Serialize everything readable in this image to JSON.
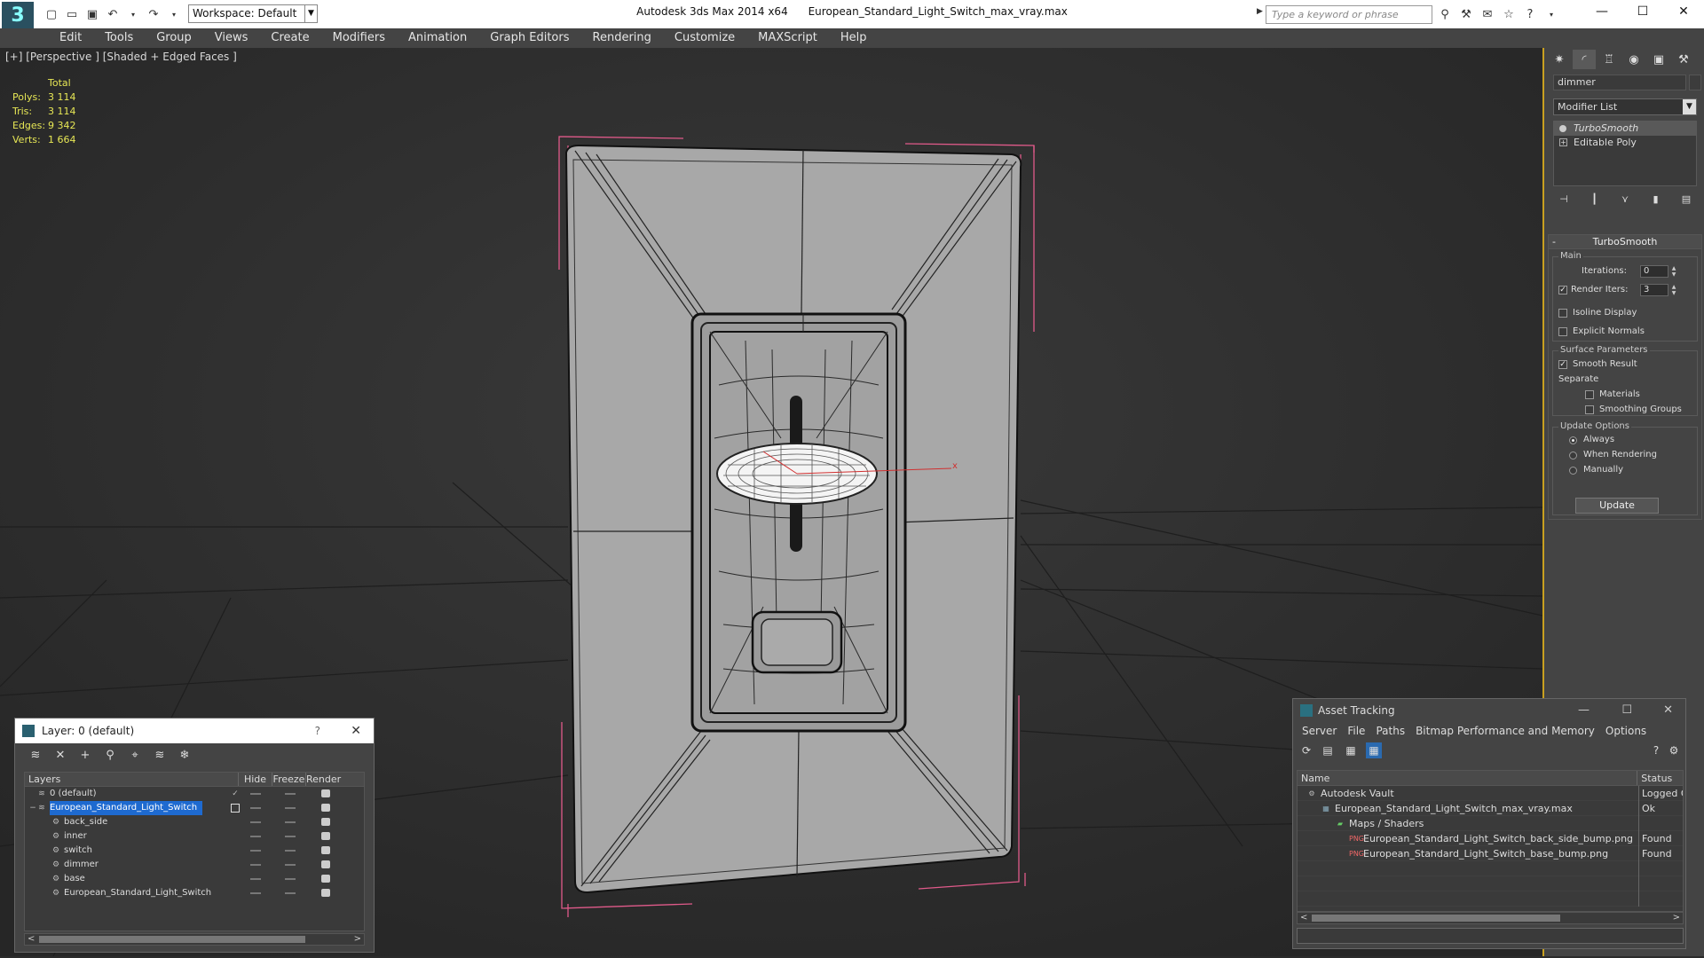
{
  "window": {
    "title": "Autodesk 3ds Max 2014 x64      European_Standard_Light_Switch_max_vray.max",
    "workspace": "Workspace: Default",
    "search_placeholder": "Type a keyword or phrase"
  },
  "menu": [
    "Edit",
    "Tools",
    "Group",
    "Views",
    "Create",
    "Modifiers",
    "Animation",
    "Graph Editors",
    "Rendering",
    "Customize",
    "MAXScript",
    "Help"
  ],
  "viewport": {
    "label": "[+] [Perspective ] [Shaded + Edged Faces ]",
    "stats": {
      "header": "Total",
      "rows": [
        {
          "k": "Polys:",
          "v": "3 114"
        },
        {
          "k": "Tris:",
          "v": "3 114"
        },
        {
          "k": "Edges:",
          "v": "9 342"
        },
        {
          "k": "Verts:",
          "v": "1 664"
        }
      ]
    },
    "gizmo_axis_label": "x"
  },
  "command_panel": {
    "object_name": "dimmer",
    "modifier_list": "Modifier List",
    "stack": [
      "TurboSmooth",
      "Editable Poly"
    ],
    "turbosmooth": {
      "title": "TurboSmooth",
      "main_group": "Main",
      "iterations_label": "Iterations:",
      "iterations_value": "0",
      "render_iters_label": "Render Iters:",
      "render_iters_value": "3",
      "isoline_display": "Isoline Display",
      "explicit_normals": "Explicit Normals",
      "surface_params": "Surface Parameters",
      "smooth_result": "Smooth Result",
      "separate": "Separate",
      "materials": "Materials",
      "smoothing_groups": "Smoothing Groups",
      "update_options": "Update Options",
      "always": "Always",
      "when_rendering": "When Rendering",
      "manually": "Manually",
      "update_button": "Update"
    }
  },
  "layer_dialog": {
    "title": "Layer: 0 (default)",
    "help": "?",
    "columns": {
      "layers": "Layers",
      "hide": "Hide",
      "freeze": "Freeze",
      "render": "Render"
    },
    "rows": [
      {
        "name": "0 (default)",
        "indent": 1
      },
      {
        "name": "European_Standard_Light_Switch",
        "indent": 1
      },
      {
        "name": "back_side",
        "indent": 2
      },
      {
        "name": "inner",
        "indent": 2
      },
      {
        "name": "switch",
        "indent": 2
      },
      {
        "name": "dimmer",
        "indent": 2
      },
      {
        "name": "base",
        "indent": 2
      },
      {
        "name": "European_Standard_Light_Switch",
        "indent": 2
      }
    ]
  },
  "asset_dialog": {
    "title": "Asset Tracking",
    "menu": [
      "Server",
      "File",
      "Paths",
      "Bitmap Performance and Memory",
      "Options"
    ],
    "columns": {
      "name": "Name",
      "status": "Status"
    },
    "rows": [
      {
        "name": "Autodesk Vault",
        "status": "Logged O",
        "icon": "vault-icon"
      },
      {
        "name": "European_Standard_Light_Switch_max_vray.max",
        "status": "Ok",
        "icon": "max-file-icon"
      },
      {
        "name": "Maps / Shaders",
        "status": "",
        "icon": "maps-icon"
      },
      {
        "name": "European_Standard_Light_Switch_back_side_bump.png",
        "status": "Found",
        "icon": "png-icon"
      },
      {
        "name": "European_Standard_Light_Switch_base_bump.png",
        "status": "Found",
        "icon": "png-icon"
      }
    ]
  },
  "colors": {
    "accent": "#c8a020",
    "selection": "#1e6ad0",
    "stats_text": "#e6e655",
    "bbox_pink": "#e05a8a"
  }
}
